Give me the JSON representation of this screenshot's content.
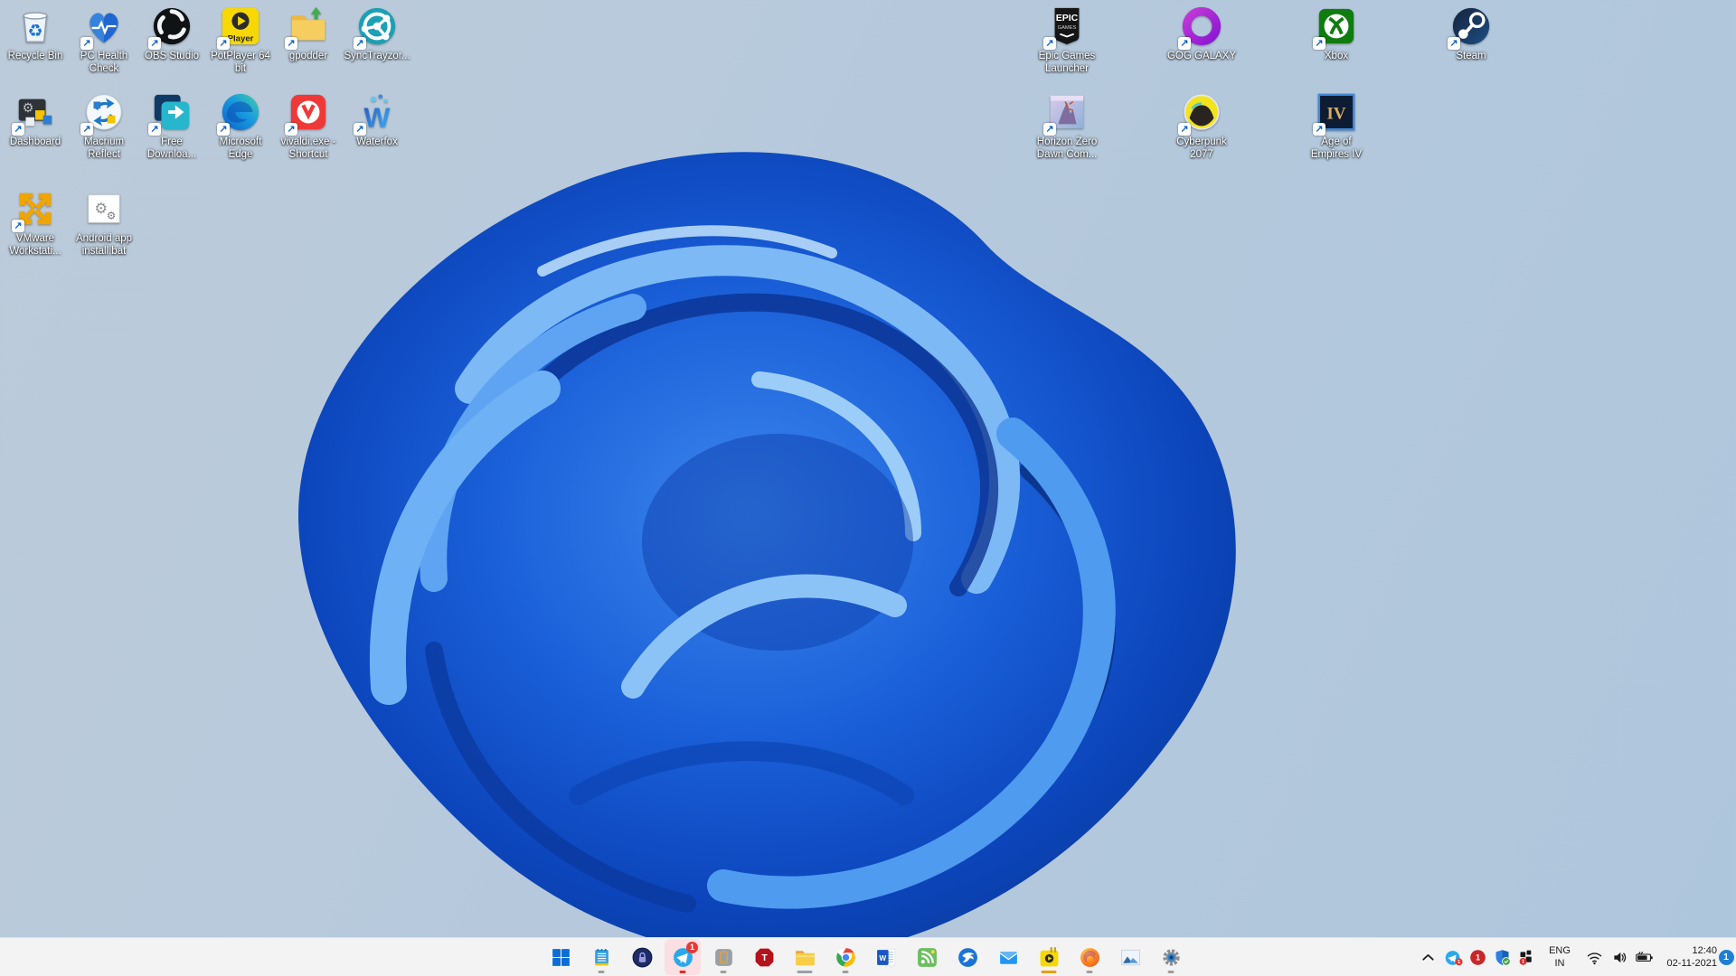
{
  "wallpaper": {
    "name": "Windows 11 Bloom",
    "background": "#b6c9dc",
    "bloom_primary": "#1a5fd8"
  },
  "colors": {
    "taskbar_bg": "#f3f3f3",
    "accent": "#1f7fd4",
    "badge_red": "#e53935",
    "label_text": "#ffffff"
  },
  "desktop": {
    "left_icon_rows": [
      [
        {
          "name": "recycle-bin",
          "label": "Recycle Bin",
          "shortcut": false
        },
        {
          "name": "pc-health-check",
          "label": "PC Health\nCheck",
          "shortcut": true
        },
        {
          "name": "obs-studio",
          "label": "OBS Studio",
          "shortcut": true
        },
        {
          "name": "potplayer-64",
          "label": "PotPlayer 64\nbit",
          "shortcut": true
        },
        {
          "name": "gpodder",
          "label": "gpodder",
          "shortcut": true
        },
        {
          "name": "synctrayzor",
          "label": "SyncTrayzor...",
          "shortcut": true
        }
      ],
      [
        {
          "name": "dashboard",
          "label": "Dashboard",
          "shortcut": true
        },
        {
          "name": "macrium-reflect",
          "label": "Macrium\nReflect",
          "shortcut": true
        },
        {
          "name": "free-download-manager",
          "label": "Free\nDownloa...",
          "shortcut": true
        },
        {
          "name": "microsoft-edge",
          "label": "Microsoft\nEdge",
          "shortcut": true
        },
        {
          "name": "vivaldi",
          "label": "vivaldi.exe -\nShortcut",
          "shortcut": true
        },
        {
          "name": "waterfox",
          "label": "Waterfox",
          "shortcut": true
        }
      ],
      [
        {
          "name": "vmware-workstation",
          "label": "VMware\nWorkstati...",
          "shortcut": true
        },
        {
          "name": "android-app-install",
          "label": "Android app\ninstall.bat",
          "shortcut": false
        }
      ]
    ],
    "right_icon_rows": [
      [
        {
          "name": "epic-games-launcher",
          "label": "Epic Games\nLauncher",
          "shortcut": true
        },
        {
          "name": "gog-galaxy",
          "label": "GOG GALAXY",
          "shortcut": true
        },
        {
          "name": "xbox",
          "label": "Xbox",
          "shortcut": true
        },
        {
          "name": "steam",
          "label": "Steam",
          "shortcut": true
        }
      ],
      [
        {
          "name": "horizon-zero-dawn",
          "label": "Horizon Zero\nDawn Com...",
          "shortcut": true
        },
        {
          "name": "cyberpunk-2077",
          "label": "Cyberpunk\n2077",
          "shortcut": true
        },
        {
          "name": "age-of-empires-iv",
          "label": "Age of\nEmpires IV",
          "shortcut": true
        }
      ]
    ]
  },
  "taskbar": {
    "apps": [
      {
        "name": "start",
        "label": "Start",
        "indicator": "none"
      },
      {
        "name": "notes-app",
        "label": "Notes",
        "indicator": "gray"
      },
      {
        "name": "keepass",
        "label": "KeePass",
        "indicator": "none"
      },
      {
        "name": "telegram",
        "label": "Telegram",
        "indicator": "red",
        "attention": true,
        "badge": "1"
      },
      {
        "name": "phone-link",
        "label": "Phone",
        "indicator": "gray"
      },
      {
        "name": "tixati",
        "label": "Tixati",
        "indicator": "none"
      },
      {
        "name": "file-explorer",
        "label": "File Explorer",
        "indicator": "gray-wide"
      },
      {
        "name": "chrome",
        "label": "Google Chrome",
        "indicator": "gray"
      },
      {
        "name": "word",
        "label": "Word",
        "indicator": "none"
      },
      {
        "name": "rss-reader",
        "label": "RSS Reader",
        "indicator": "none"
      },
      {
        "name": "thunderbird",
        "label": "Thunderbird",
        "indicator": "none"
      },
      {
        "name": "mail",
        "label": "Mail",
        "indicator": "none"
      },
      {
        "name": "potplayer",
        "label": "PotPlayer",
        "indicator": "orange"
      },
      {
        "name": "firefox",
        "label": "Firefox",
        "indicator": "gray"
      },
      {
        "name": "photos",
        "label": "Photos",
        "indicator": "none"
      },
      {
        "name": "settings",
        "label": "Settings",
        "indicator": "gray"
      }
    ],
    "tray": {
      "hidden_icons_chevron": "^",
      "icons": [
        "telegram-tray",
        "red-badge-1",
        "windows-security",
        "tray-app-badge-1"
      ],
      "language": {
        "line1": "ENG",
        "line2": "IN"
      },
      "network": "wifi",
      "volume": "speaker",
      "battery": "charging",
      "clock": {
        "time": "12:40",
        "date": "02-11-2021"
      },
      "notification_count": "1"
    }
  }
}
